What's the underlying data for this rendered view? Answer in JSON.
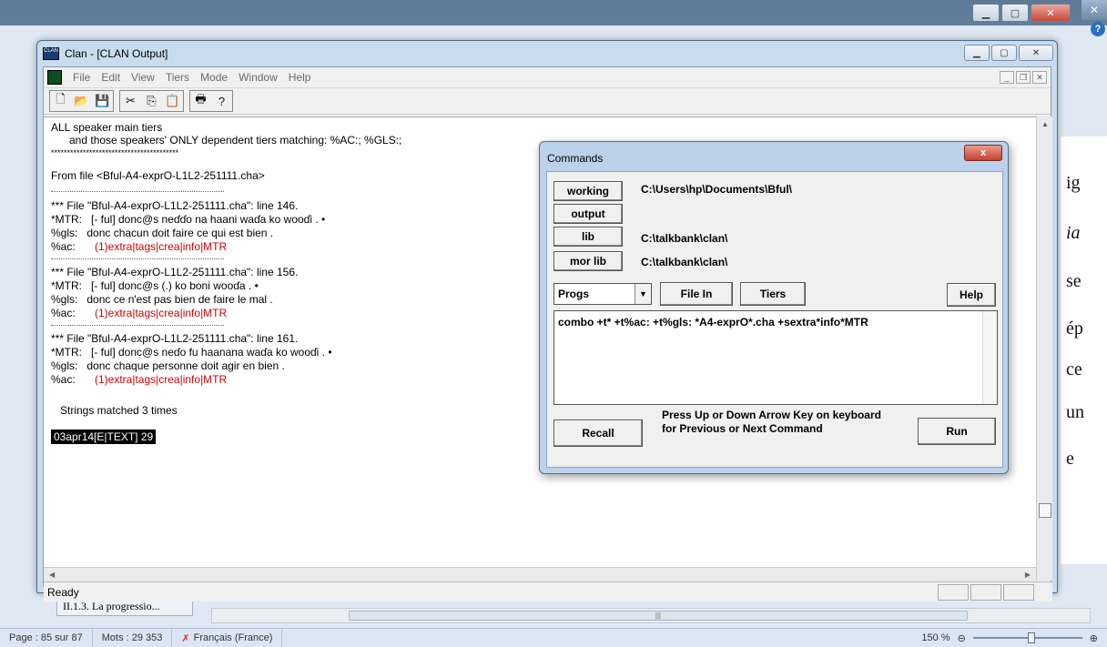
{
  "word": {
    "doc_fragments": [
      "ig",
      "ia",
      "se",
      "ép",
      "ce",
      "un",
      "e"
    ],
    "nav_item": "II.1.3.  La progressio...",
    "status": {
      "page": "Page : 85 sur 87",
      "words": "Mots : 29 353",
      "language": "Français (France)",
      "zoom": "150 %"
    }
  },
  "clan": {
    "title": "Clan - [CLAN Output]",
    "menu": [
      "File",
      "Edit",
      "View",
      "Tiers",
      "Mode",
      "Window",
      "Help"
    ],
    "status": "Ready",
    "output_lines": [
      "ALL speaker main tiers",
      "      and those speakers' ONLY dependent tiers matching: %AC:; %GLS:;",
      "****************************************",
      "From file <Bful-A4-exprO-L1L2-251111.cha>",
      "*** File \"Bful-A4-exprO-L1L2-251111.cha\": line 146.",
      "*MTR:   [- ful] donc@s neɗɗo na haani waɗa ko wooɗi . •",
      "%gls:   donc chacun doit faire ce qui est bien .",
      "%ac:   ",
      "(1)extra|tags|crea|info|MTR",
      "*** File \"Bful-A4-exprO-L1L2-251111.cha\": line 156.",
      "*MTR:   [- ful] donc@s (.) ko boni wooɗa . •",
      "%gls:   donc ce n'est pas bien de faire le mal .",
      "%ac:   ",
      "(1)extra|tags|crea|info|MTR",
      "*** File \"Bful-A4-exprO-L1L2-251111.cha\": line 161.",
      "*MTR:   [- ful] donc@s neɗo fu haanana waɗa ko wooɗi . •",
      "%gls:   donc chaque personne doit agir en bien .",
      "%ac:   ",
      "(1)extra|tags|crea|info|MTR",
      "   Strings matched 3 times"
    ],
    "tag_line": "03apr14[E|TEXT]   29"
  },
  "commands": {
    "title": "Commands",
    "close": "x",
    "buttons": {
      "working": "working",
      "output": "output",
      "lib": "lib",
      "mor_lib": "mor lib",
      "file_in": "File In",
      "tiers": "Tiers",
      "help": "Help",
      "recall": "Recall",
      "run": "Run"
    },
    "paths": {
      "working": "C:\\Users\\hp\\Documents\\Bful\\",
      "lib": "C:\\talkbank\\clan\\",
      "mor_lib": "C:\\talkbank\\clan\\"
    },
    "progs_selected": "Progs",
    "command_text": "combo +t* +t%ac: +t%gls: *A4-exprO*.cha +sextra*info*MTR",
    "hint": "Press Up or Down Arrow Key on keyboard for Previous or Next Command"
  }
}
